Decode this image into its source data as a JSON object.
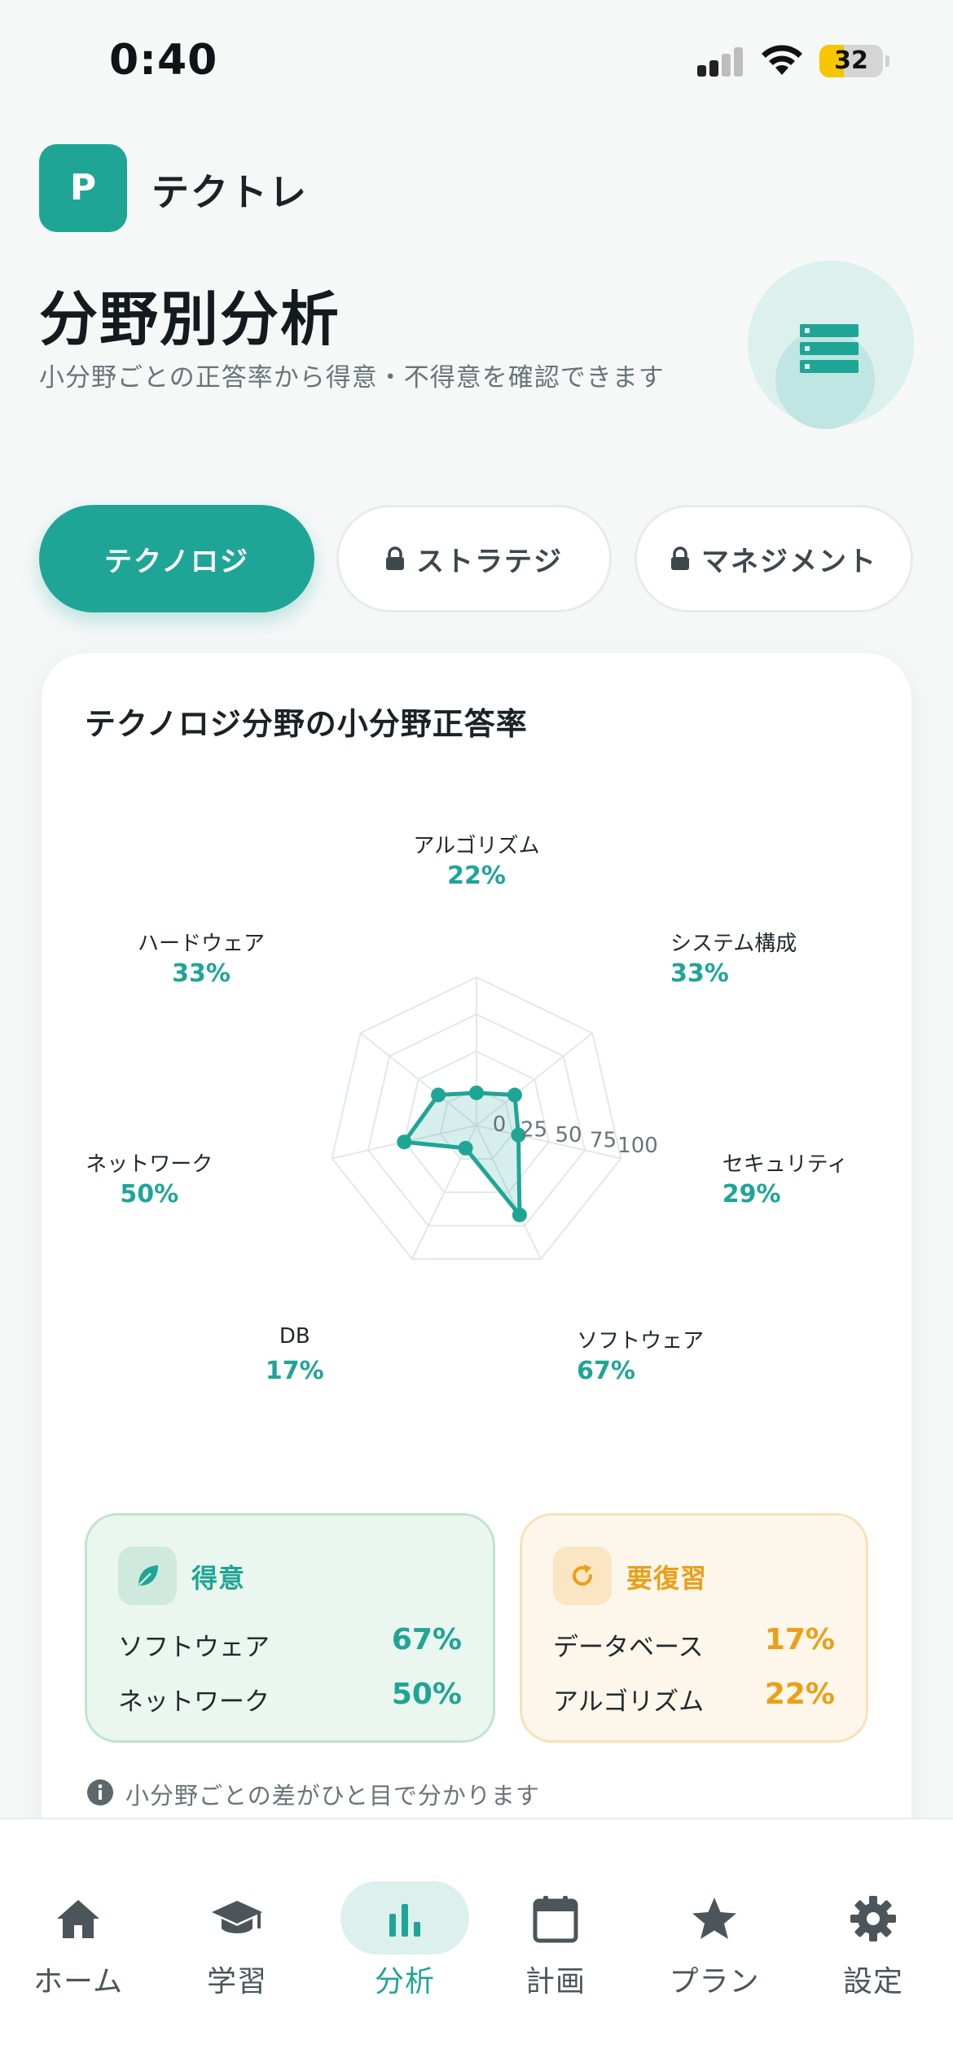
{
  "status_bar": {
    "time": "0:40",
    "battery": "32",
    "battery_level": 0.32
  },
  "app": {
    "logo_letter": "P",
    "name": "テクトレ"
  },
  "page": {
    "title": "分野別分析",
    "subtitle": "小分野ごとの正答率から得意・不得意を確認できます",
    "hero_icon": "database-icon"
  },
  "tabs": [
    {
      "label": "テクノロジ",
      "active": true,
      "locked": false
    },
    {
      "label": "ストラテジ",
      "active": false,
      "locked": true
    },
    {
      "label": "マネジメント",
      "active": false,
      "locked": true
    }
  ],
  "card": {
    "title": "テクノロジ分野の小分野正答率",
    "hint": "小分野ごとの差がひと目で分かります"
  },
  "chart_data": {
    "type": "radar",
    "title": "テクノロジ分野の小分野正答率",
    "scale": {
      "min": 0,
      "max": 100,
      "ticks": [
        0,
        25,
        50,
        75,
        100
      ]
    },
    "categories": [
      "アルゴリズム",
      "システム構成",
      "セキュリティ",
      "ソフトウェア",
      "DB",
      "ネットワーク",
      "ハードウェア"
    ],
    "series": [
      {
        "values": [
          22,
          33,
          29,
          67,
          17,
          50,
          33
        ]
      }
    ],
    "value_labels": [
      "22%",
      "33%",
      "29%",
      "67%",
      "17%",
      "50%",
      "33%"
    ],
    "colors": {
      "line": "#1fa596",
      "fill": "#1fa596",
      "grid": "#e4e7e8"
    }
  },
  "strengths": {
    "title": "得意",
    "icon": "leaf-icon",
    "items": [
      {
        "label": "ソフトウェア",
        "value": "67%"
      },
      {
        "label": "ネットワーク",
        "value": "50%"
      }
    ]
  },
  "review": {
    "title": "要復習",
    "icon": "refresh-icon",
    "items": [
      {
        "label": "データベース",
        "value": "17%"
      },
      {
        "label": "アルゴリズム",
        "value": "22%"
      }
    ]
  },
  "nav": {
    "items": [
      {
        "label": "ホーム",
        "icon": "home-icon",
        "active": false
      },
      {
        "label": "学習",
        "icon": "graduation-cap-icon",
        "active": false
      },
      {
        "label": "分析",
        "icon": "bar-chart-icon",
        "active": true
      },
      {
        "label": "計画",
        "icon": "calendar-icon",
        "active": false
      },
      {
        "label": "プラン",
        "icon": "star-icon",
        "active": false
      },
      {
        "label": "設定",
        "icon": "gear-icon",
        "active": false
      }
    ]
  },
  "colors": {
    "accent": "#1fa596",
    "warning": "#ec9f16"
  }
}
